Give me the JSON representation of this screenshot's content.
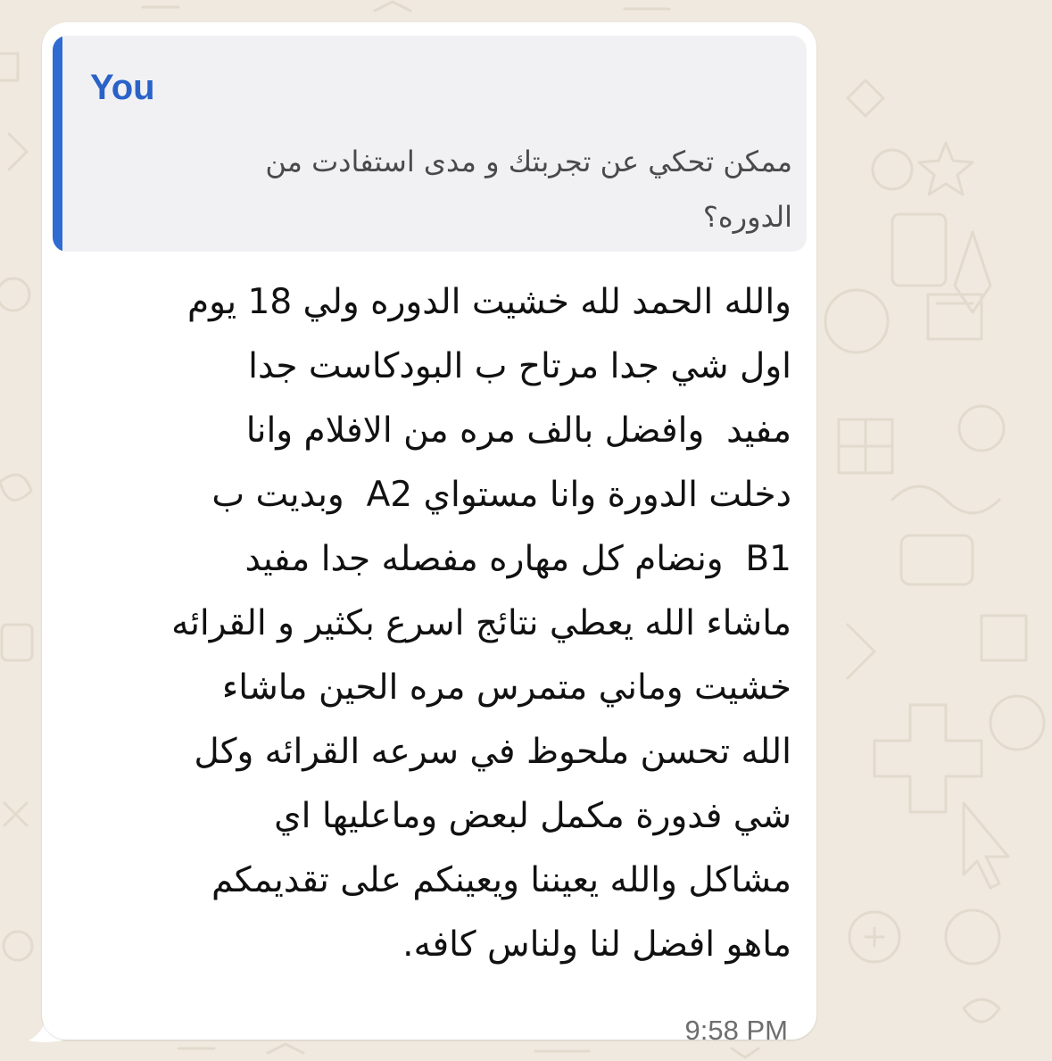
{
  "quoted_message": {
    "author": "You",
    "text": "ممكن تحكي عن تجربتك و مدى استفادت من\nالدوره؟"
  },
  "message": {
    "text": "والله الحمد لله خشيت الدوره ولي 18 يوم\nاول شي جدا مرتاح ب البودكاست جدا\nمفيد  وافضل بالف مره من الافلام وانا\nدخلت الدورة وانا مستواي A2  وبديت ب\nB1  ونضام كل مهاره مفصله جدا مفيد\nماشاء الله يعطي نتائج اسرع بكثير و القرائه\nخشيت وماني متمرس مره الحين ماشاء\nالله تحسن ملحوظ في سرعه القرائه وكل\nشي فدورة مكمل لبعض وماعليها اي\nمشاكل والله يعيننا ويعينكم على تقديمكم\nماهو افضل لنا ولناس كافه.",
    "time": "9:58 PM"
  },
  "colors": {
    "wallpaper": "#efe9df",
    "bubble": "#ffffff",
    "quote_background": "#f1f1f4",
    "quote_bar": "#2f6bd0",
    "quote_author": "#2a62c8"
  }
}
